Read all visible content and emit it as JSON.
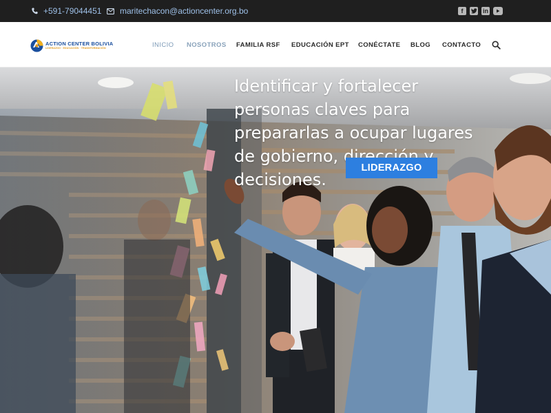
{
  "topbar": {
    "phone": "+591-79044451",
    "email": "maritechacon@actioncenter.org.bo",
    "social_icons": [
      "facebook-icon",
      "twitter-icon",
      "linkedin-icon",
      "youtube-icon"
    ]
  },
  "logo": {
    "name": "ACTION CENTER BOLIVIA",
    "tagline": "LIDERAZGO · EDUCACIÓN · TRANSFORMACIÓN"
  },
  "nav": {
    "items": [
      {
        "label": "INICIO",
        "state": "active"
      },
      {
        "label": "NOSOTROS",
        "state": "current"
      },
      {
        "label": "FAMILIA RSF",
        "state": "default"
      },
      {
        "label": "EDUCACIÓN EPT",
        "state": "default"
      },
      {
        "label": "CONÉCTATE",
        "state": "default"
      },
      {
        "label": "BLOG",
        "state": "default"
      },
      {
        "label": "CONTACTO",
        "state": "default"
      }
    ],
    "search_icon": "search-icon"
  },
  "hero": {
    "heading": "Identificar y fortalecer personas claves para prepararlas a ocupar lugares de gobierno, dirección y decisiones.",
    "button_label": "LIDERAZGO"
  },
  "colors": {
    "topbar_bg": "#1f1f1f",
    "accent_link": "#9ec0e8",
    "button_blue": "#2d7fe0",
    "logo_blue": "#1a4f9e",
    "logo_orange": "#e39a1c"
  }
}
